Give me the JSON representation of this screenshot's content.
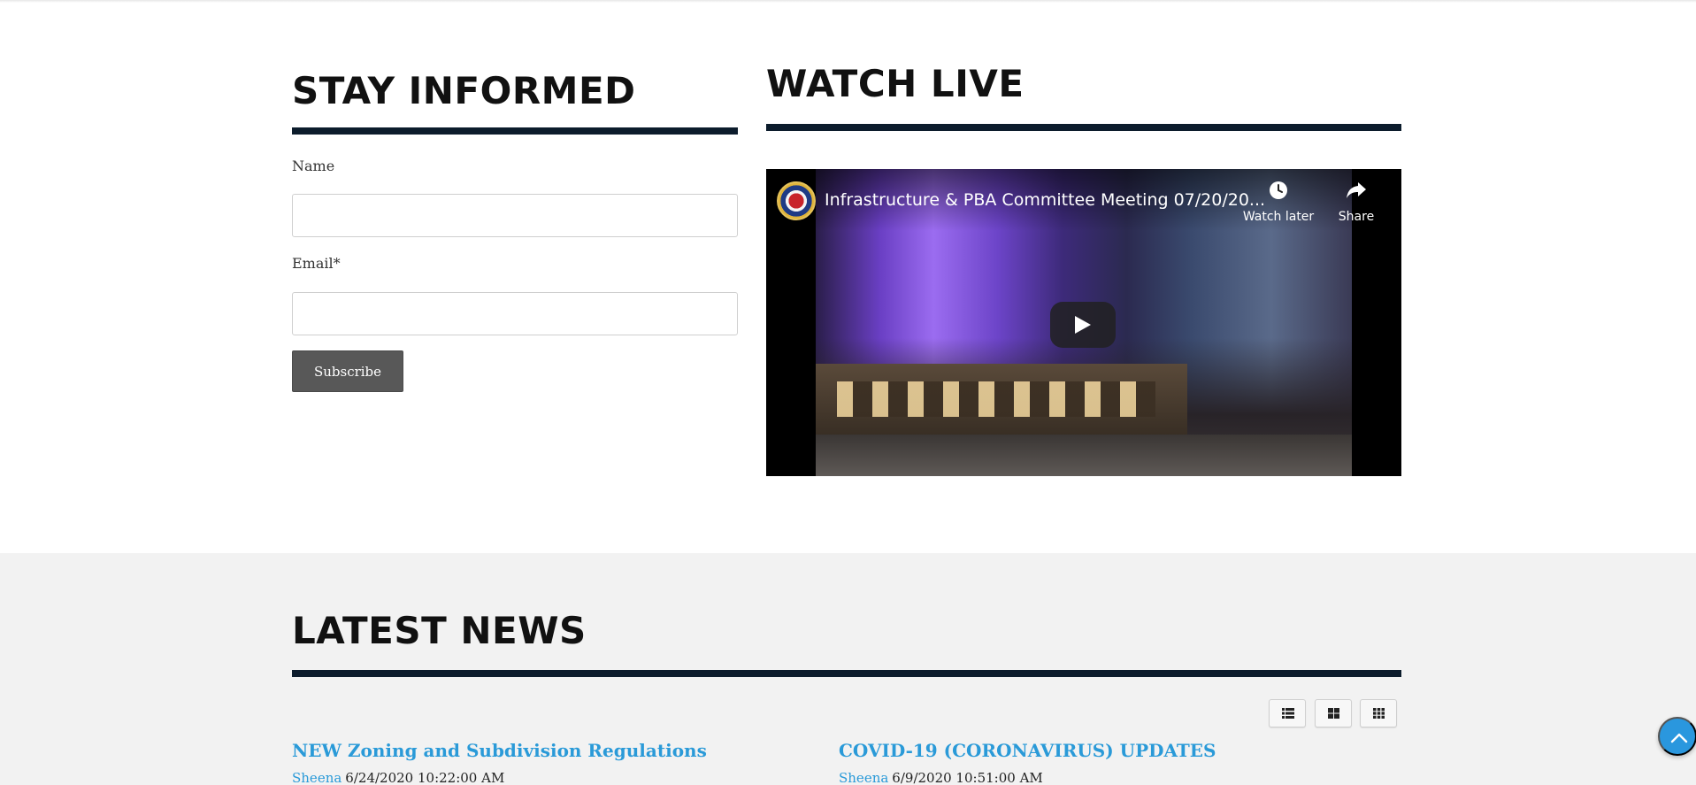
{
  "stay_informed": {
    "heading": "STAY INFORMED",
    "name_label": "Name",
    "name_value": "",
    "email_label": "Email*",
    "email_value": "",
    "subscribe_label": "Subscribe"
  },
  "watch_live": {
    "heading": "WATCH LIVE",
    "video_title": "Infrastructure & PBA Committee Meeting 07/20/20...",
    "watch_later_label": "Watch later",
    "share_label": "Share",
    "channel_logo_icon": "county-seal-icon",
    "play_icon": "play-icon"
  },
  "latest_news": {
    "heading": "LATEST NEWS",
    "view_toggles": [
      {
        "icon": "list-view-icon"
      },
      {
        "icon": "grid-2-view-icon"
      },
      {
        "icon": "grid-3-view-icon"
      }
    ],
    "articles": [
      {
        "title": "NEW Zoning and Subdivision Regulations",
        "author": "Sheena",
        "date": "6/24/2020 10:22:00 AM"
      },
      {
        "title": "COVID-19 (CORONAVIRUS) UPDATES",
        "author": "Sheena",
        "date": "6/9/2020 10:51:00 AM"
      }
    ]
  },
  "scroll_top": {
    "icon": "chevron-up-icon"
  },
  "colors": {
    "rule": "#0c1c2c",
    "link": "#2a9ad8",
    "subscribe_bg": "#585858",
    "news_bg": "#f2f2f2",
    "scroll_top_bg": "#2a97de"
  }
}
